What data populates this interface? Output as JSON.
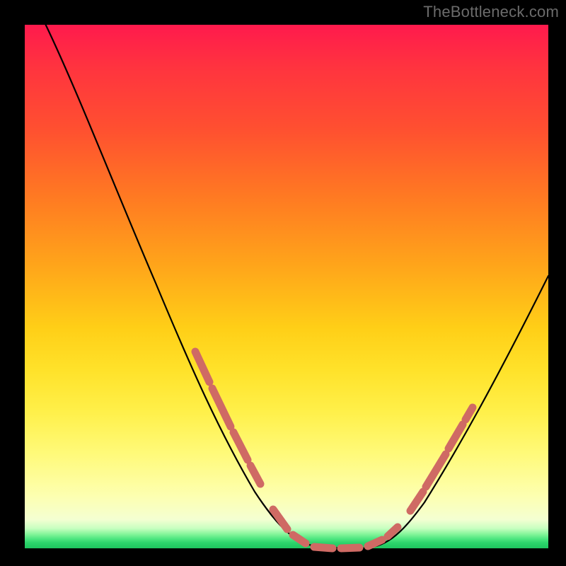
{
  "watermark": "TheBottleneck.com",
  "chart_data": {
    "type": "line",
    "title": "",
    "xlabel": "",
    "ylabel": "",
    "xlim": [
      0,
      100
    ],
    "ylim": [
      0,
      100
    ],
    "grid": false,
    "legend": null,
    "gradient_colors": {
      "top": "#ff1a4d",
      "mid_upper": "#ff7a22",
      "mid": "#ffe22a",
      "mid_lower": "#fdffb0",
      "bottom": "#1fc55f"
    },
    "curve_description": "asymmetric V-shaped curve; steep descent from upper-left, flat trough between x≈47 and x≈67 at y≈0, moderate ascent to y≈52 at x=100",
    "series": [
      {
        "name": "bottleneck-curve",
        "stroke": "#000000",
        "x": [
          4,
          8,
          12,
          16,
          20,
          24,
          28,
          32,
          36,
          40,
          44,
          48,
          52,
          56,
          60,
          64,
          68,
          72,
          76,
          80,
          84,
          88,
          92,
          96,
          100
        ],
        "y": [
          100,
          92,
          83,
          74,
          65,
          56,
          47,
          38,
          30,
          23,
          16,
          9,
          4,
          1,
          0,
          0,
          1,
          5,
          11,
          18,
          25,
          32,
          39,
          46,
          52
        ]
      }
    ],
    "highlight_segments": [
      {
        "name": "left-red-band",
        "stroke": "#d16a66",
        "width_fraction": 0.014,
        "x": [
          32,
          36,
          40,
          44
        ],
        "y": [
          38,
          30,
          23,
          16
        ]
      },
      {
        "name": "trough-red-band",
        "stroke": "#d16a66",
        "width_fraction": 0.014,
        "x": [
          50,
          54,
          58,
          62,
          66,
          70
        ],
        "y": [
          2.5,
          0.8,
          0,
          0,
          0.8,
          3
        ]
      },
      {
        "name": "right-red-band",
        "stroke": "#d16a66",
        "width_fraction": 0.014,
        "x": [
          74,
          80,
          84
        ],
        "y": [
          8,
          18,
          25
        ]
      }
    ]
  }
}
